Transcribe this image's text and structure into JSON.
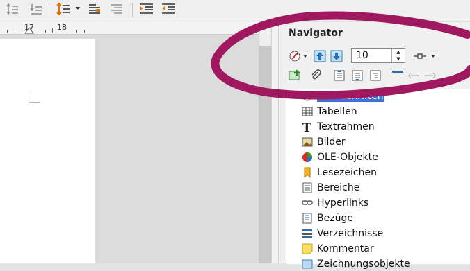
{
  "toolbar": {
    "icons": [
      "line-spacing-icon",
      "paragraph-spacing-below-icon",
      "line-spacing-menu-icon",
      "align-left-icon",
      "align-right-icon",
      "increase-indent-icon",
      "decrease-indent-icon"
    ]
  },
  "ruler": {
    "labels": [
      "17",
      "18"
    ]
  },
  "navigator": {
    "title": "Navigator",
    "spin_value": "10",
    "items": [
      {
        "label": "Überschriften",
        "icon": "headings-icon",
        "selected": true
      },
      {
        "label": "Tabellen",
        "icon": "table-icon"
      },
      {
        "label": "Textrahmen",
        "icon": "text-frame-icon"
      },
      {
        "label": "Bilder",
        "icon": "image-icon"
      },
      {
        "label": "OLE-Objekte",
        "icon": "ole-object-icon"
      },
      {
        "label": "Lesezeichen",
        "icon": "bookmark-icon"
      },
      {
        "label": "Bereiche",
        "icon": "section-icon"
      },
      {
        "label": "Hyperlinks",
        "icon": "hyperlink-icon"
      },
      {
        "label": "Bezüge",
        "icon": "reference-icon"
      },
      {
        "label": "Verzeichnisse",
        "icon": "index-icon"
      },
      {
        "label": "Kommentar",
        "icon": "comment-icon"
      },
      {
        "label": "Zeichnungsobjekte",
        "icon": "drawing-object-icon"
      }
    ]
  },
  "colors": {
    "annotation": "#a0185f",
    "selection": "#3875d7"
  }
}
